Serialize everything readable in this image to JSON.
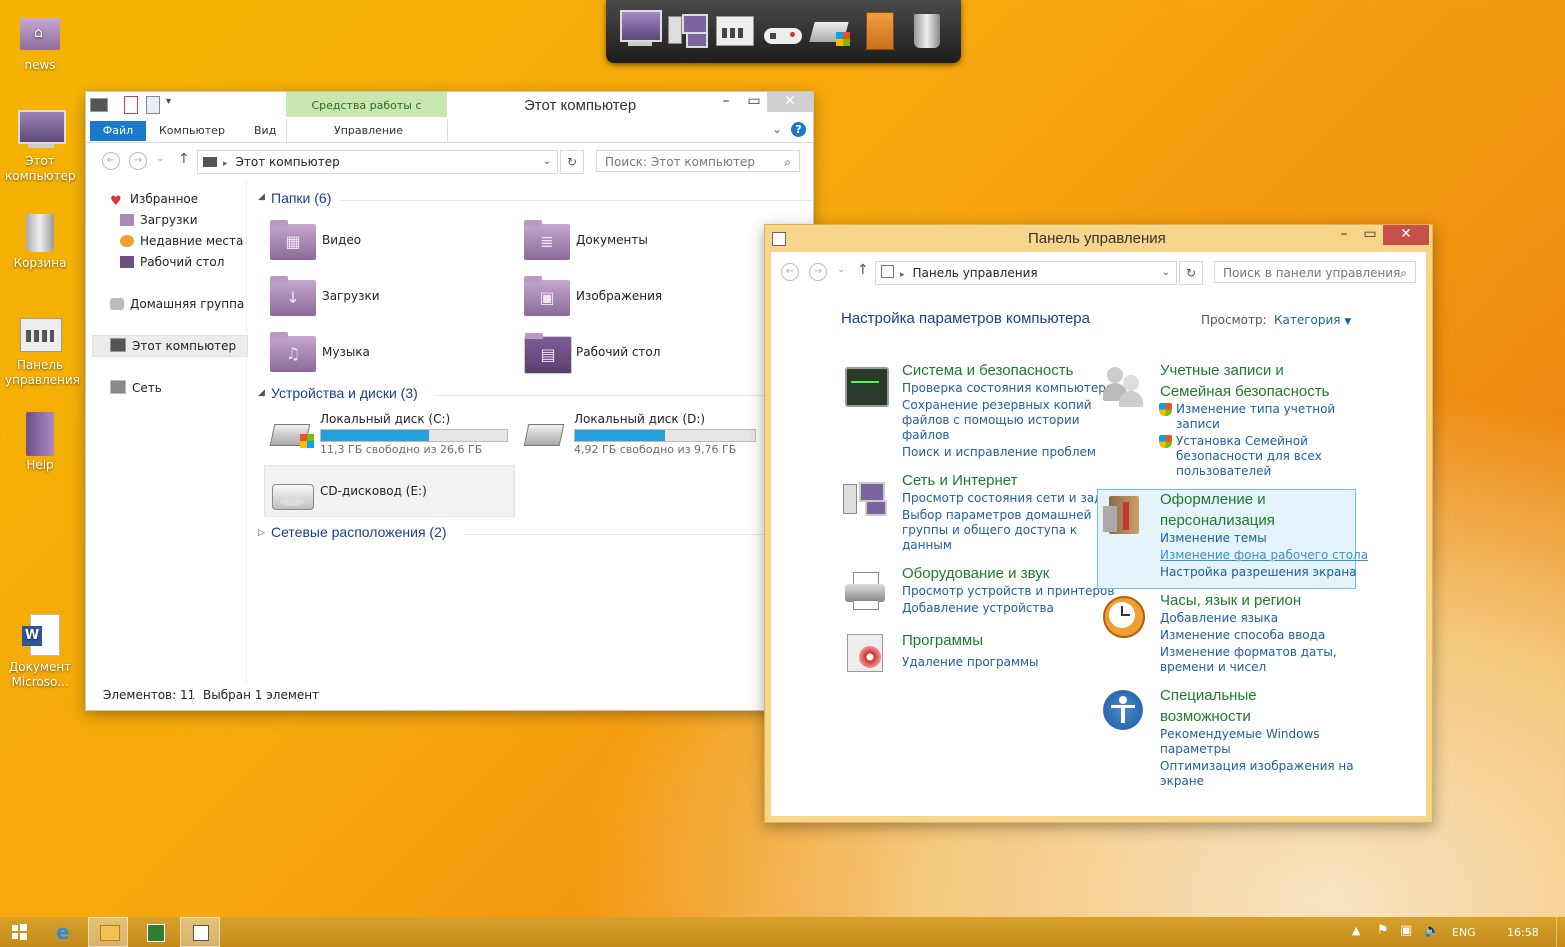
{
  "desktop": {
    "icons": [
      {
        "label": "news"
      },
      {
        "label": "Этот компьютер"
      },
      {
        "label": "Корзина"
      },
      {
        "label": "Панель управления"
      },
      {
        "label": "Help"
      },
      {
        "label": "Документ Microso..."
      }
    ]
  },
  "explorer": {
    "title": "Этот компьютер",
    "context_tab_group": "Средства работы с дисками",
    "tabs": [
      "Файл",
      "Компьютер",
      "Вид",
      "Управление"
    ],
    "address": "Этот компьютер",
    "search_placeholder": "Поиск: Этот компьютер",
    "nav": {
      "favorites": "Избранное",
      "downloads": "Загрузки",
      "recent": "Недавние места",
      "desktop": "Рабочий стол",
      "homegroup": "Домашняя группа",
      "this_pc": "Этот компьютер",
      "network": "Сеть"
    },
    "folders_header": "Папки (6)",
    "folders": [
      "Видео",
      "Документы",
      "Загрузки",
      "Изображения",
      "Музыка",
      "Рабочий стол"
    ],
    "devices_header": "Устройства и диски (3)",
    "drives": [
      {
        "name": "Локальный диск (C:)",
        "free": "11,3 ГБ свободно из 26,6 ГБ",
        "used_fraction": 0.58
      },
      {
        "name": "Локальный диск (D:)",
        "free": "4,92 ГБ свободно из 9,76 ГБ",
        "used_fraction": 0.5
      },
      {
        "name": "CD-дисковод (E:)"
      }
    ],
    "network_header": "Сетевые расположения (2)",
    "status_items": "Элементов: 11",
    "status_selected": "Выбран 1 элемент"
  },
  "cpanel": {
    "title": "Панель управления",
    "address": "Панель управления",
    "search_placeholder": "Поиск в панели управления",
    "heading": "Настройка параметров компьютера",
    "view_label": "Просмотр:",
    "view_value": "Категория",
    "categories": {
      "system": {
        "title": "Система и безопасность",
        "links": [
          "Проверка состояния компьютера",
          "Сохранение резервных копий",
          "файлов с помощью истории",
          "файлов",
          "Поиск и исправление проблем"
        ]
      },
      "network": {
        "title": "Сеть и Интернет",
        "links": [
          "Просмотр состояния сети и задач",
          "Выбор параметров домашней",
          "группы и общего доступа к",
          "данным"
        ]
      },
      "hardware": {
        "title": "Оборудование и звук",
        "links": [
          "Просмотр устройств и принтеров",
          "Добавление устройства"
        ]
      },
      "programs": {
        "title": "Программы",
        "links": [
          "Удаление программы"
        ]
      },
      "accounts": {
        "title_1": "Учетные записи и",
        "title_2": "Семейная безопасность",
        "links": [
          "Изменение типа учетной",
          "записи",
          "Установка Семейной",
          "безопасности для всех",
          "пользователей"
        ]
      },
      "appearance": {
        "title_1": "Оформление и",
        "title_2": "персонализация",
        "links": [
          "Изменение темы",
          "Изменение фона рабочего стола",
          "Настройка разрешения экрана"
        ]
      },
      "clock": {
        "title": "Часы, язык и регион",
        "links": [
          "Добавление языка",
          "Изменение способа ввода",
          "Изменение форматов даты,",
          "времени и чисел"
        ]
      },
      "access": {
        "title_1": "Специальные",
        "title_2": "возможности",
        "links": [
          "Рекомендуемые Windows",
          "параметры",
          "Оптимизация изображения на",
          "экране"
        ]
      }
    }
  },
  "taskbar": {
    "lang": "ENG",
    "time": "16:58"
  },
  "colors": {
    "accent": "#1979ca",
    "link": "#1e5fa0",
    "category_green": "#1e7a2e",
    "desktop_orange": "#f6a60e"
  }
}
